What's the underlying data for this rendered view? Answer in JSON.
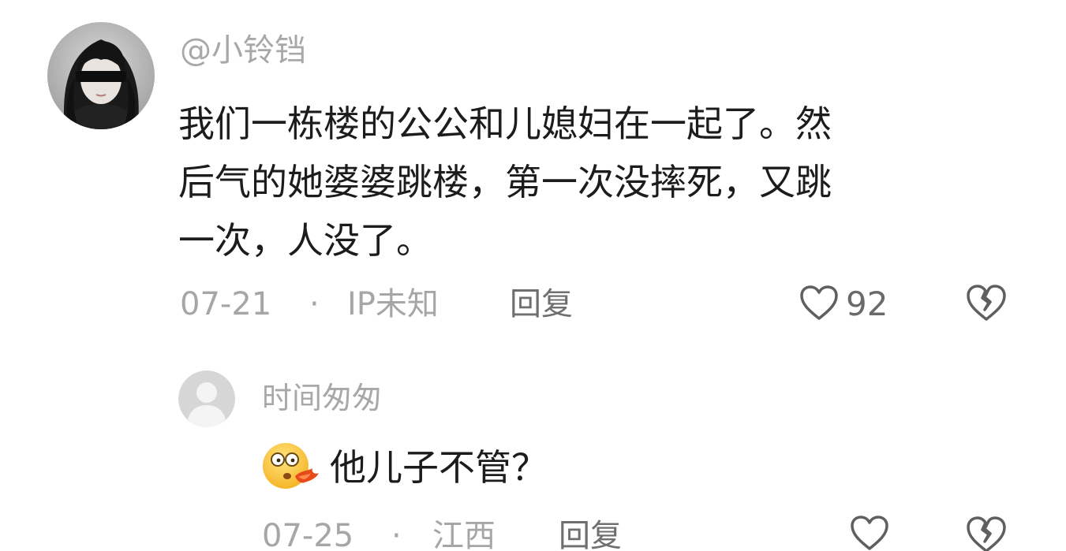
{
  "comment": {
    "username": "@小铃铛",
    "text_lines": [
      "我们一栋楼的公公和儿媳妇在一起了。然",
      "后气的她婆婆跳楼，第一次没摔死，又跳",
      "一次，人没了。"
    ],
    "date": "07-21",
    "separator": "·",
    "location": "IP未知",
    "reply_label": "回复",
    "like_count": "92",
    "icons": {
      "like": "heart-outline-icon",
      "dislike": "broken-heart-icon"
    }
  },
  "reply": {
    "username": "时间匆匆",
    "emoji": "flushed-sick-face-emoji",
    "text": "他儿子不管？",
    "date": "07-25",
    "separator": "·",
    "location": "江西",
    "reply_label": "回复",
    "icons": {
      "like": "heart-outline-icon",
      "dislike": "broken-heart-icon"
    }
  },
  "colors": {
    "meta_text": "#a6a6a6",
    "reply_label": "#6f6f6f",
    "body_text": "#1c1c1c",
    "icon_stroke": "#5f5f5f"
  }
}
